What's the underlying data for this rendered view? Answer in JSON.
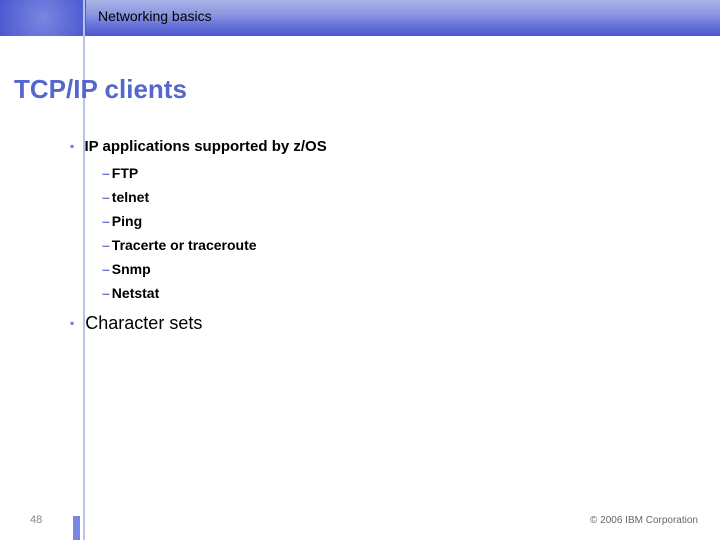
{
  "header": {
    "section": "Networking basics"
  },
  "title": "TCP/IP clients",
  "bullets": {
    "main": "IP applications supported by z/OS",
    "items": [
      "FTP",
      "telnet",
      "Ping",
      "Tracerte or traceroute",
      "Snmp",
      "Netstat"
    ],
    "second": "Character sets"
  },
  "footer": {
    "page": "48",
    "copyright": "© 2006 IBM Corporation"
  }
}
